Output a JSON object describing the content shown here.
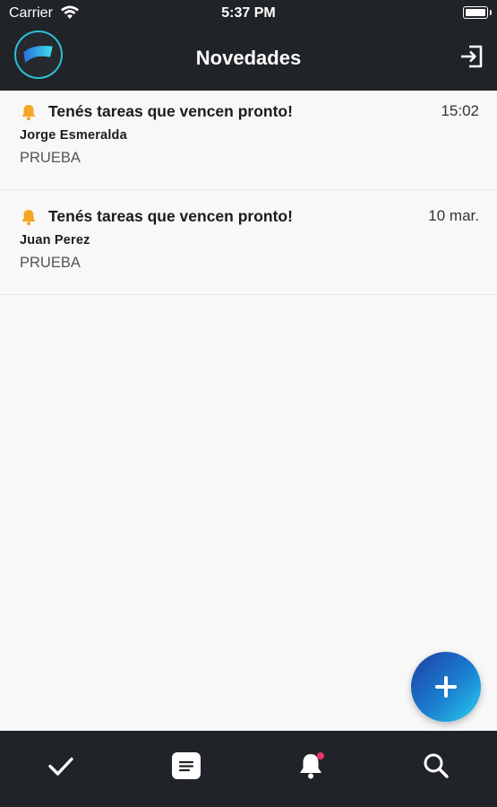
{
  "status_bar": {
    "carrier": "Carrier",
    "time": "5:37 PM",
    "icons": [
      "wifi-icon",
      "battery-icon"
    ]
  },
  "header": {
    "title": "Novedades",
    "logo_icon": "app-logo",
    "action_icon": "logout-icon"
  },
  "notifications": [
    {
      "icon": "bell-icon",
      "title": "Tenés tareas que vencen pronto!",
      "time": "15:02",
      "author": "Jorge Esmeralda",
      "body": "PRUEBA"
    },
    {
      "icon": "bell-icon",
      "title": "Tenés tareas que vencen pronto!",
      "time": "10 mar.",
      "author": "Juan Perez",
      "body": "PRUEBA"
    }
  ],
  "fab": {
    "icon": "plus-icon"
  },
  "tab_bar": {
    "items": [
      {
        "icon": "check-icon"
      },
      {
        "icon": "notes-icon"
      },
      {
        "icon": "bell-icon",
        "badge": true
      },
      {
        "icon": "search-icon"
      }
    ]
  },
  "colors": {
    "header_bg": "#202327",
    "background": "#f8f8f8",
    "bell": "#f5a623",
    "accent_start": "#1d3ea3",
    "accent_end": "#2ad0ee",
    "badge": "#e8336a"
  }
}
